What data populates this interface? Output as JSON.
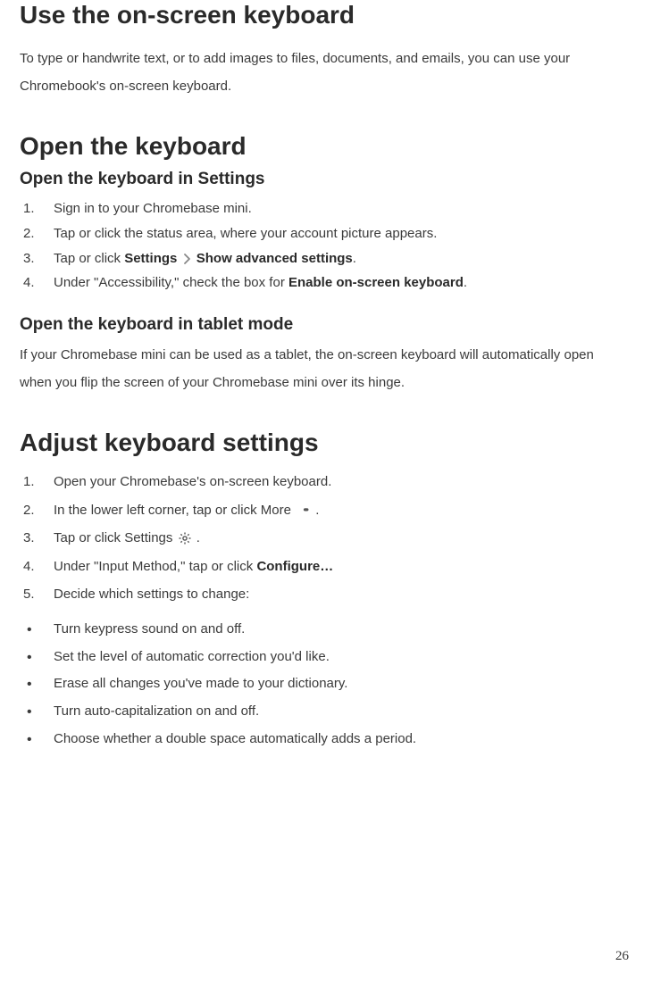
{
  "heading1": "Use the on-screen keyboard",
  "intro": "To type or handwrite text, or to add images to files, documents, and emails, you can use your Chromebook's on-screen keyboard.",
  "heading2": "Open the keyboard",
  "subheading2a": "Open the keyboard in Settings",
  "settings_steps": {
    "s1": "Sign in to your Chromebase mini.",
    "s2": "Tap or click the status area, where your account picture appears.",
    "s3a": "Tap or click ",
    "s3b_bold": "Settings",
    "s3c_bold": " Show advanced settings",
    "s3d": ".",
    "s4a": "Under \"Accessibility,\" check the box for ",
    "s4b_bold": "Enable on-screen keyboard",
    "s4c": "."
  },
  "subheading2b": "Open the keyboard in tablet mode",
  "tablet_para": "If your Chromebase mini can be used as a tablet, the on-screen keyboard will automatically open when you flip the screen of your Chromebase mini over its hinge.",
  "heading3": "Adjust keyboard settings",
  "adjust_steps": {
    "s1": "Open your Chromebase's on-screen keyboard.",
    "s2a": "In the lower left corner, tap or click More ",
    "s2b": " .",
    "s3a": "Tap or click Settings ",
    "s3b": " .",
    "s4a": "Under \"Input Method,\" tap or click ",
    "s4b_bold": "Configure…",
    "s5": "Decide which settings to change:"
  },
  "bullets": {
    "b1": "Turn keypress sound on and off.",
    "b2": "Set the level of automatic correction you'd like.",
    "b3": "Erase all changes you've made to your dictionary.",
    "b4": "Turn auto-capitalization on and off.",
    "b5": "Choose whether a double space automatically adds a period."
  },
  "page_number": "26"
}
